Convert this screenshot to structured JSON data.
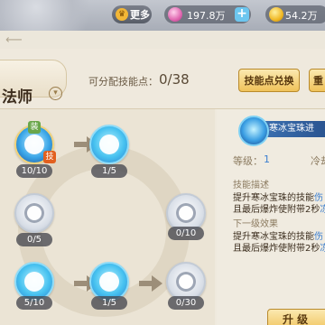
{
  "topbar": {
    "more_label": "更多",
    "gem_value": "197.8万",
    "coin_value": "54.2万"
  },
  "header": {
    "class_name": "法师",
    "points_label": "可分配技能点：",
    "points_value": "0/38",
    "exchange_label": "技能点兑换",
    "reset_label": "重"
  },
  "tree": {
    "nodes": [
      {
        "count": "10/10",
        "badge_top": "装",
        "badge_side": "技"
      },
      {
        "count": "1/5"
      },
      {
        "count": "0/5"
      },
      {
        "count": "0/10"
      },
      {
        "count": "5/10"
      },
      {
        "count": "1/5"
      },
      {
        "count": "0/30"
      }
    ]
  },
  "detail": {
    "skill_name": "寒冰宝珠进",
    "level_label": "等级：",
    "level_value": "1",
    "cd_label": "冷却",
    "desc_title": "技能描述",
    "desc_line1_a": "提升寒冰宝珠的技能",
    "desc_line1_b": "伤",
    "desc_line2_a": "且最后爆炸使附带2秒",
    "desc_line2_b": "冻",
    "next_title": "下一级效果",
    "next_line1_a": "提升寒冰宝珠的技能",
    "next_line1_b": "伤",
    "next_line2_a": "且最后爆炸使附带2秒",
    "next_line2_b": "冻",
    "upgrade_label": "升 级"
  },
  "colors": {
    "accent_gold": "#f0c25a",
    "skill_blue": "#3a7ed0",
    "panel_bg": "#efe9dd"
  },
  "icons": {
    "more": "crown-icon",
    "gem": "gem-icon",
    "coin": "coin-icon",
    "add": "plus-icon",
    "back": "back-arrow-icon"
  }
}
